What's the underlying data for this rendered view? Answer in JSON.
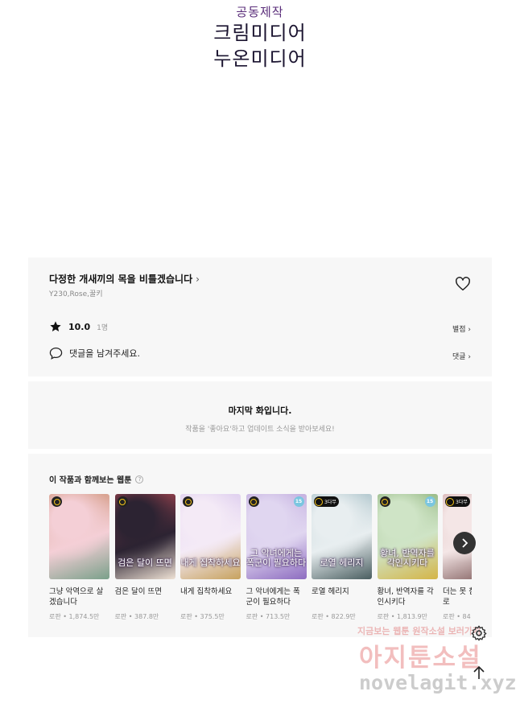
{
  "credits": {
    "studio": "공동제작",
    "line1": "크림미디어",
    "line2": "누온미디어"
  },
  "series": {
    "title": "다정한 개새끼의 목을 비틀겠습니다",
    "authors": "Y230,Rose,꿀키",
    "rating": "10.0",
    "rating_count": "1명",
    "rate_link": "별점",
    "comment_prompt": "댓글을 남겨주세요.",
    "comment_link": "댓글"
  },
  "last_episode": {
    "title": "마지막 화입니다.",
    "subtitle": "작품을 '좋아요'하고 업데이트 소식을 받아보세요!"
  },
  "recommend": {
    "heading": "이 작품과 함께보는 웹툰",
    "help_glyph": "?",
    "items": [
      {
        "title": "그냥 악역으로 살겠습니다",
        "meta": "로판 • 1,874.5만",
        "badge": "clock",
        "cover": "",
        "colors": [
          "#f4cfd6",
          "#c98a6a",
          "#7aa08a"
        ]
      },
      {
        "title": "검은 달이 뜨면",
        "meta": "로판 • 387.8만",
        "badge": "clock",
        "cover": "검은 달이 뜨면",
        "colors": [
          "#2c2332",
          "#b74b55",
          "#efe2d5"
        ]
      },
      {
        "title": "내게 집착하세요",
        "meta": "로판 • 375.5만",
        "badge": "clock",
        "cover": "내게 집착하세요",
        "colors": [
          "#f4eaf6",
          "#d6c4ec",
          "#c7a25e"
        ]
      },
      {
        "title": "그 악녀에게는 폭군이 필요하다",
        "meta": "로판 • 713.5만",
        "badge": "clock+15",
        "cover": "그 악녀에게는 폭군이 필요하다",
        "colors": [
          "#e0d6f0",
          "#b79fd8",
          "#8d6cc0"
        ]
      },
      {
        "title": "로열 헤리지",
        "meta": "로판 • 822.9만",
        "badge": "3다무",
        "cover": "로열 헤리지",
        "colors": [
          "#e8eef0",
          "#9cb8c0",
          "#4a5e60"
        ]
      },
      {
        "title": "황녀, 반역자를 각인시키다",
        "meta": "로판 • 1,813.9만",
        "badge": "clock+15",
        "cover": "황녀, 반역자를 각인시키다",
        "colors": [
          "#cfe4c6",
          "#7fa76a",
          "#d4b548"
        ]
      },
      {
        "title": "더는 못 참지 않기로",
        "meta": "로판 • 84",
        "badge": "3다무",
        "cover": "",
        "colors": [
          "#f4e6e6",
          "#c99a9a",
          "#7a5656"
        ]
      }
    ]
  },
  "watermark": {
    "line1": "지금보는 웹툰 원작소설 보러가기",
    "line2": "아지툰소설",
    "line3": "novelagit.xyz"
  },
  "icons": {
    "heart": "heart-outline-icon",
    "star": "star-icon",
    "comment": "speech-bubble-icon",
    "next": "chevron-right-icon",
    "settings": "gear-icon",
    "top": "arrow-up-icon"
  }
}
